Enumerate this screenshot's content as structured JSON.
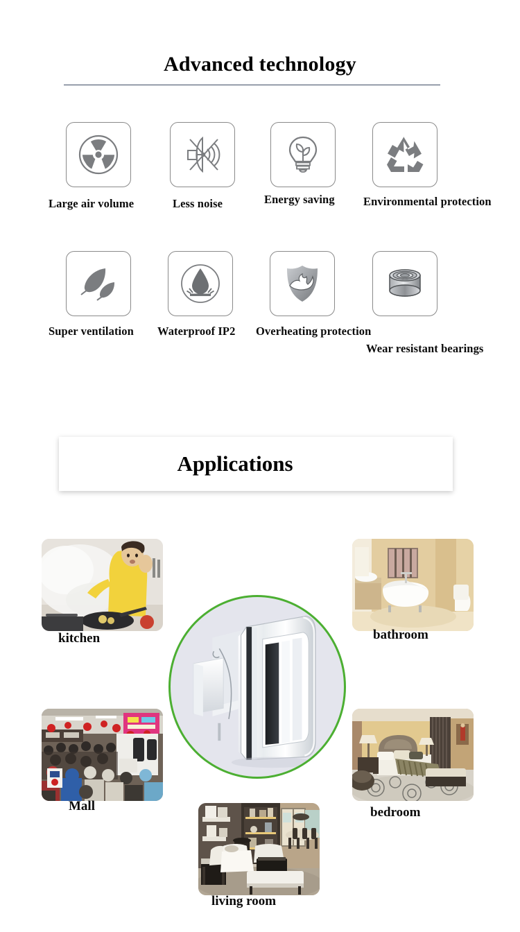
{
  "sections": {
    "technology": {
      "title": "Advanced technology",
      "features": [
        {
          "label": "Large air volume",
          "icon": "fan-blade-icon"
        },
        {
          "label": "Less noise",
          "icon": "muted-speaker-icon"
        },
        {
          "label": "Energy saving",
          "icon": "lightbulb-leaf-icon"
        },
        {
          "label": "Environmental protection",
          "icon": "recycle-icon"
        },
        {
          "label": "Super ventilation",
          "icon": "two-leaves-icon"
        },
        {
          "label": "Waterproof  IP2",
          "icon": "water-drop-icon"
        },
        {
          "label": "Overheating protection",
          "icon": "shield-flame-icon"
        },
        {
          "label": "Wear resistant bearings",
          "icon": "bearing-icon"
        }
      ]
    },
    "applications": {
      "title": "Applications",
      "product_image_alt": "wall-mounted-exhaust-fan",
      "items": [
        {
          "label": "kitchen",
          "photo": "kitchen-photo"
        },
        {
          "label": "bathroom",
          "photo": "bathroom-photo"
        },
        {
          "label": "Mall",
          "photo": "mall-photo"
        },
        {
          "label": "bedroom",
          "photo": "bedroom-photo"
        },
        {
          "label": "living room",
          "photo": "living-room-photo"
        }
      ]
    }
  },
  "colors": {
    "rule": "#3c4a63",
    "ring": "#4caf32",
    "circle_fill": "#e4e5ed",
    "icon_border": "#8a8a8a",
    "icon_gray": "#7b7d80",
    "text": "#0b0b0b"
  }
}
